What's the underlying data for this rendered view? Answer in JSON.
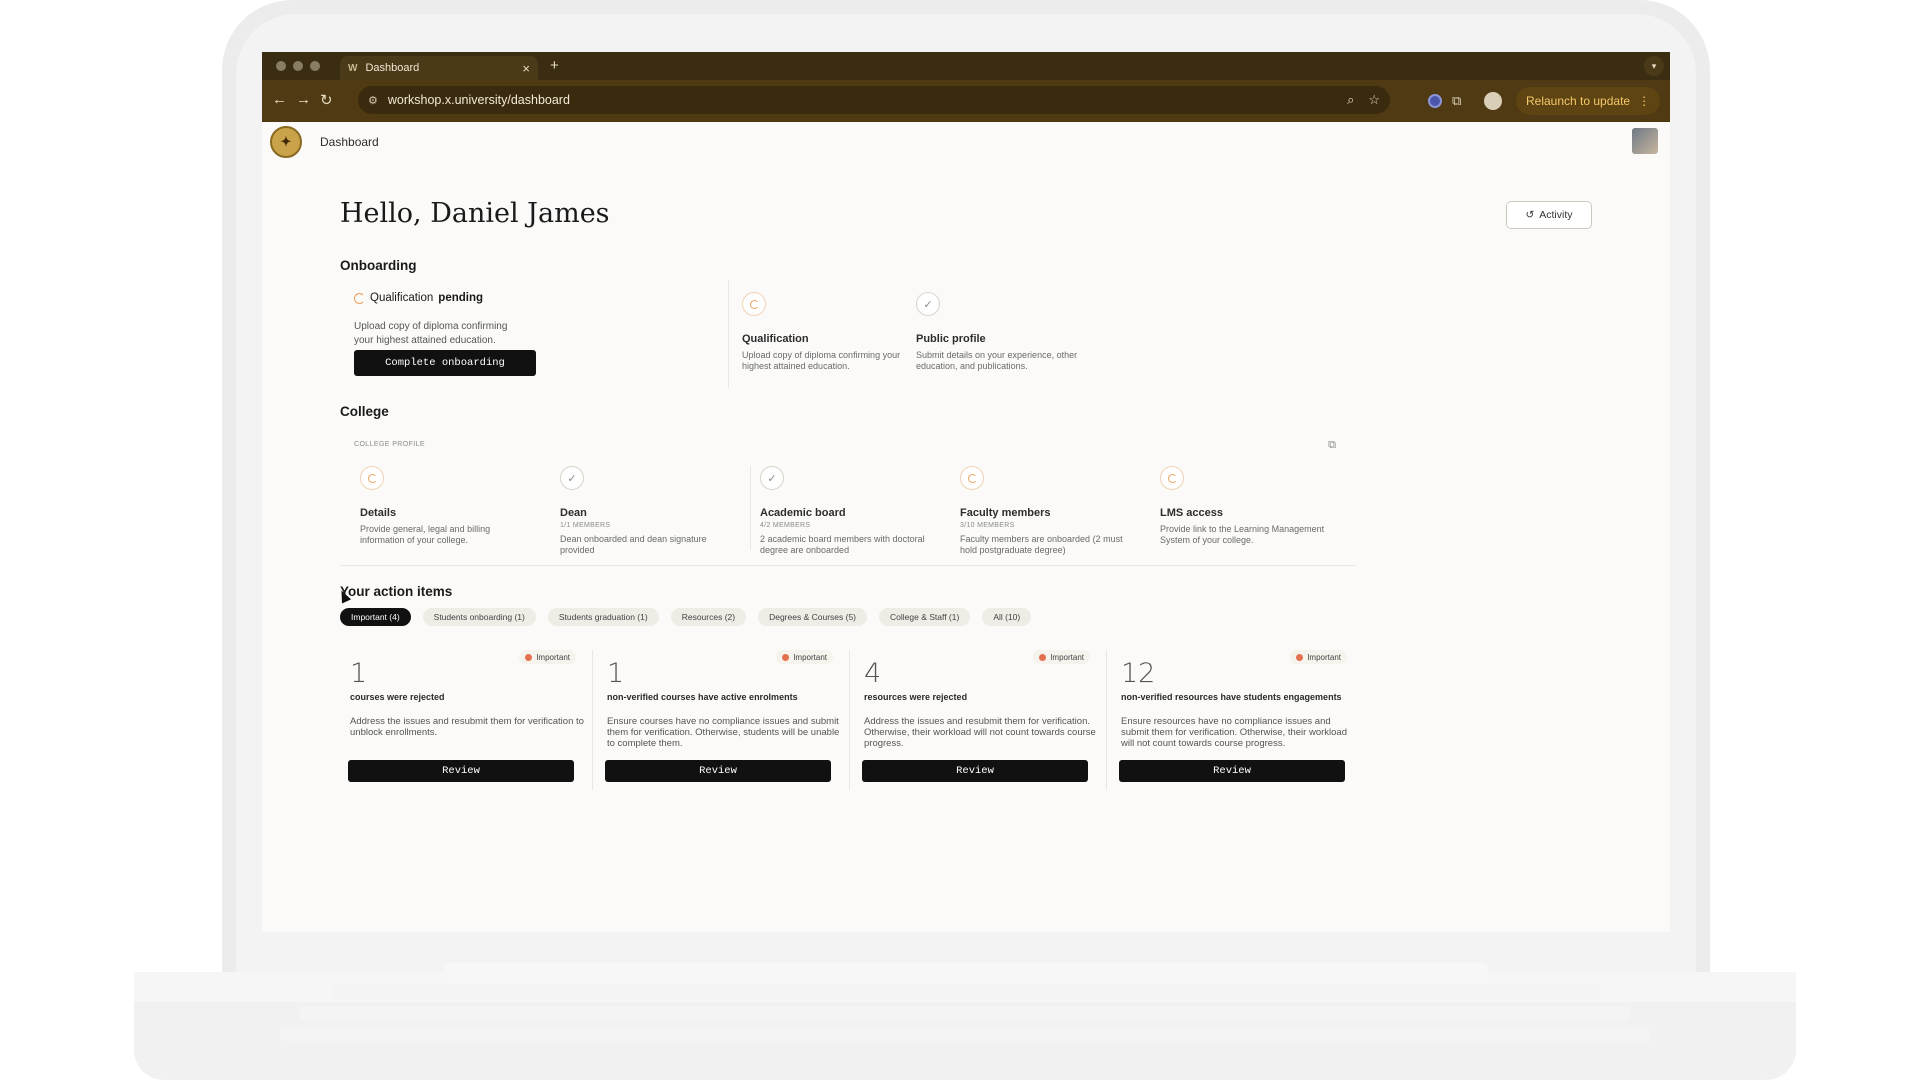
{
  "browser": {
    "tab_title": "Dashboard",
    "tab_favicon": "W",
    "url": "workshop.x.university/dashboard",
    "relaunch_label": "Relaunch to update"
  },
  "app": {
    "title": "Dashboard"
  },
  "greeting": "Hello, Daniel James",
  "activity_label": "Activity",
  "onboarding": {
    "title": "Onboarding",
    "status_prefix": "Qualification",
    "status_value": "pending",
    "description": "Upload copy of diploma confirming your highest attained education.",
    "button_label": "Complete onboarding",
    "steps": [
      {
        "title": "Qualification",
        "description": "Upload copy of diploma confirming your highest attained education.",
        "state": "pending"
      },
      {
        "title": "Public profile",
        "description": "Submit details on your experience, other education, and publications.",
        "state": "done"
      }
    ]
  },
  "college": {
    "title": "College",
    "profile_label": "COLLEGE PROFILE",
    "steps": [
      {
        "title": "Details",
        "meta": "",
        "description": "Provide general, legal and billing information of your college.",
        "state": "pending"
      },
      {
        "title": "Dean",
        "meta": "1/1 MEMBERS",
        "description": "Dean onboarded and dean signature provided",
        "state": "done"
      },
      {
        "title": "Academic board",
        "meta": "4/2 MEMBERS",
        "description": "2 academic board members with doctoral degree are onboarded",
        "state": "done"
      },
      {
        "title": "Faculty members",
        "meta": "3/10 MEMBERS",
        "description": "Faculty members are onboarded (2 must hold postgraduate degree)",
        "state": "pending"
      },
      {
        "title": "LMS access",
        "meta": "",
        "description": "Provide link to the Learning Management System of your college.",
        "state": "pending"
      }
    ]
  },
  "actions": {
    "title": "Your action items",
    "filters": [
      "Important (4)",
      "Students onboarding (1)",
      "Students graduation (1)",
      "Resources (2)",
      "Degrees & Courses (5)",
      "College & Staff (1)",
      "All (10)"
    ],
    "cards": [
      {
        "badge": "Important",
        "count": "1",
        "label": "courses were rejected",
        "description": "Address the issues and resubmit them for verification to unblock enrollments.",
        "button": "Review"
      },
      {
        "badge": "Important",
        "count": "1",
        "label": "non-verified courses have active enrolments",
        "description": "Ensure courses have no compliance issues and submit them for verification. Otherwise, students will be unable to complete them.",
        "button": "Review"
      },
      {
        "badge": "Important",
        "count": "4",
        "label": "resources were rejected",
        "description": "Address the issues and resubmit them for verification. Otherwise, their workload will not count towards course progress.",
        "button": "Review"
      },
      {
        "badge": "Important",
        "count": "12",
        "label": "non-verified resources have students engagements",
        "description": "Ensure resources have no compliance issues and submit them for verification. Otherwise, their workload will not count towards course progress.",
        "button": "Review"
      }
    ]
  },
  "colors": {
    "chrome_dark": "#3b2d12",
    "chrome_toolbar": "#4f3a13",
    "relaunch_text": "#f4c86a",
    "pending_orange": "#e9a15e",
    "important_dot": "#e2704f",
    "primary_button": "#111111"
  },
  "icons": {
    "back": "arrow-left-icon",
    "forward": "arrow-right-icon",
    "reload": "reload-icon",
    "site_info": "tune-icon",
    "zoom": "search-icon",
    "bookmark": "star-icon",
    "extensions": "puzzle-icon",
    "history": "history-icon",
    "external": "external-link-icon"
  }
}
